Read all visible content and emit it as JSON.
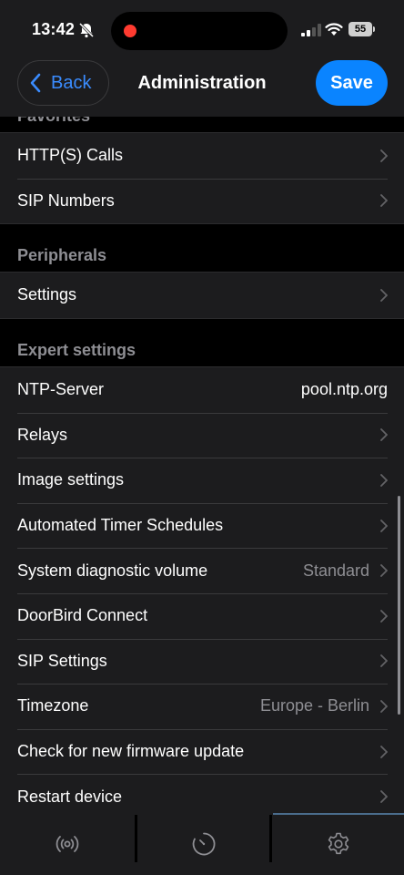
{
  "status_bar": {
    "time": "13:42",
    "battery": "55",
    "icons": [
      "bell-slash-icon",
      "signal-icon",
      "wifi-icon",
      "battery-icon"
    ]
  },
  "nav": {
    "back_label": "Back",
    "title": "Administration",
    "save_label": "Save"
  },
  "sections": {
    "favorites": {
      "header": "Favorites",
      "items": [
        {
          "label": "HTTP(S) Calls"
        },
        {
          "label": "SIP Numbers"
        }
      ]
    },
    "peripherals": {
      "header": "Peripherals",
      "items": [
        {
          "label": "Settings"
        }
      ]
    },
    "expert": {
      "header": "Expert settings",
      "items": [
        {
          "label": "NTP-Server",
          "value": "pool.ntp.org"
        },
        {
          "label": "Relays"
        },
        {
          "label": "Image settings"
        },
        {
          "label": "Automated Timer Schedules"
        },
        {
          "label": "System diagnostic volume",
          "value": "Standard"
        },
        {
          "label": "DoorBird Connect"
        },
        {
          "label": "SIP Settings"
        },
        {
          "label": "Timezone",
          "value": "Europe - Berlin"
        },
        {
          "label": "Check for new firmware update"
        },
        {
          "label": "Restart device"
        }
      ]
    }
  },
  "tab_bar": {
    "tabs": [
      {
        "icon": "live-broadcast-icon",
        "active": false
      },
      {
        "icon": "history-clock-icon",
        "active": false
      },
      {
        "icon": "settings-gear-icon",
        "active": true
      }
    ]
  },
  "colors": {
    "accent": "#0a84ff",
    "background": "#000000",
    "group_background": "#1c1c1e",
    "secondary_text": "#8e8e93"
  }
}
